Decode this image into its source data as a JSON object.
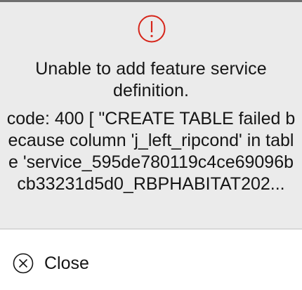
{
  "alert": {
    "icon": "alert-circle-icon",
    "icon_color": "#d6251a",
    "title": "Unable to add feature service definition.",
    "details": "code: 400 [ \"CREATE TABLE failed because column 'j_left_ripcond' in table 'service_595de780119c4ce69096bcb33231d5d0_RBPHABITAT202..."
  },
  "footer": {
    "close_icon": "close-circle-icon",
    "close_label": "Close"
  },
  "colors": {
    "panel_background": "#ebebeb",
    "text": "#151515"
  }
}
